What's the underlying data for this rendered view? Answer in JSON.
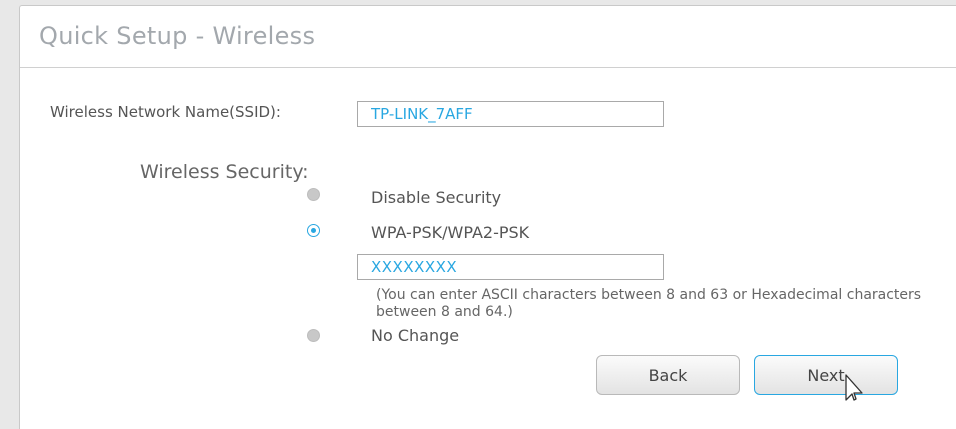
{
  "header": {
    "title": "Quick Setup - Wireless"
  },
  "ssid": {
    "label": "Wireless Network Name(SSID):",
    "value": "TP-LINK_7AFF"
  },
  "security": {
    "label": "Wireless Security:",
    "options": [
      {
        "label": "Disable Security",
        "selected": false
      },
      {
        "label": "WPA-PSK/WPA2-PSK",
        "selected": true
      },
      {
        "label": "No Change",
        "selected": false
      }
    ],
    "password_value": "XXXXXXXX",
    "hint": "(You can enter ASCII characters between 8 and 63 or Hexadecimal characters between 8 and 64.)"
  },
  "buttons": {
    "back_label": "Back",
    "next_label": "Next"
  },
  "colors": {
    "accent": "#29a7e1",
    "title": "#a3a8ad",
    "text": "#555555"
  },
  "icons": {
    "cursor": "mouse-pointer-icon"
  }
}
